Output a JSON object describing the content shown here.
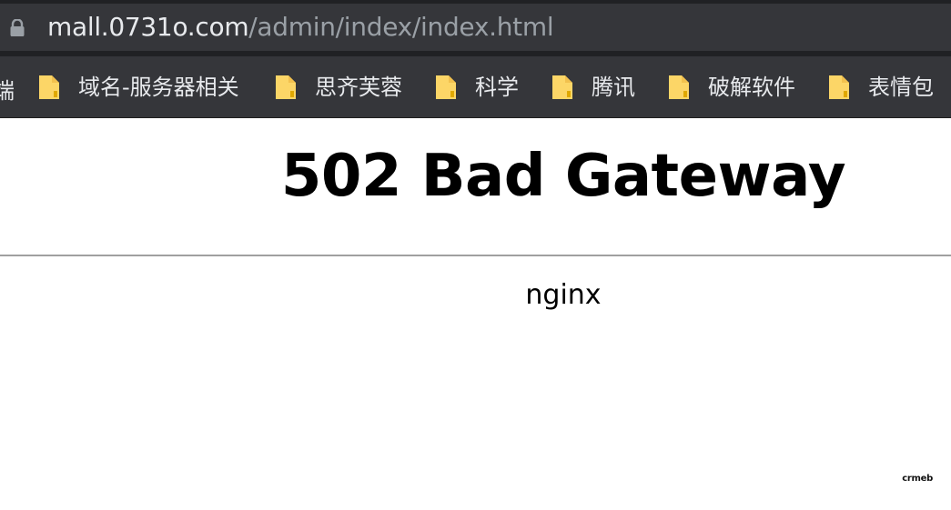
{
  "browser": {
    "url_host": "mall.0731o.com",
    "url_path": "/admin/index/index.html",
    "icons": {
      "lock": "lock-icon",
      "folder": "folder-icon"
    },
    "colors": {
      "toolbar_bg": "#35363a",
      "url_host": "#e8eaed",
      "url_path": "#9aa0a6",
      "folder": "#fcd667"
    }
  },
  "bookmarks": {
    "partial_label": "端",
    "items": [
      {
        "label": "域名-服务器相关"
      },
      {
        "label": "思齐芙蓉"
      },
      {
        "label": "科学"
      },
      {
        "label": "腾讯"
      },
      {
        "label": "破解软件"
      },
      {
        "label": "表情包"
      }
    ]
  },
  "page": {
    "title": "502 Bad Gateway",
    "server": "nginx",
    "logo_text": "crmeb"
  }
}
